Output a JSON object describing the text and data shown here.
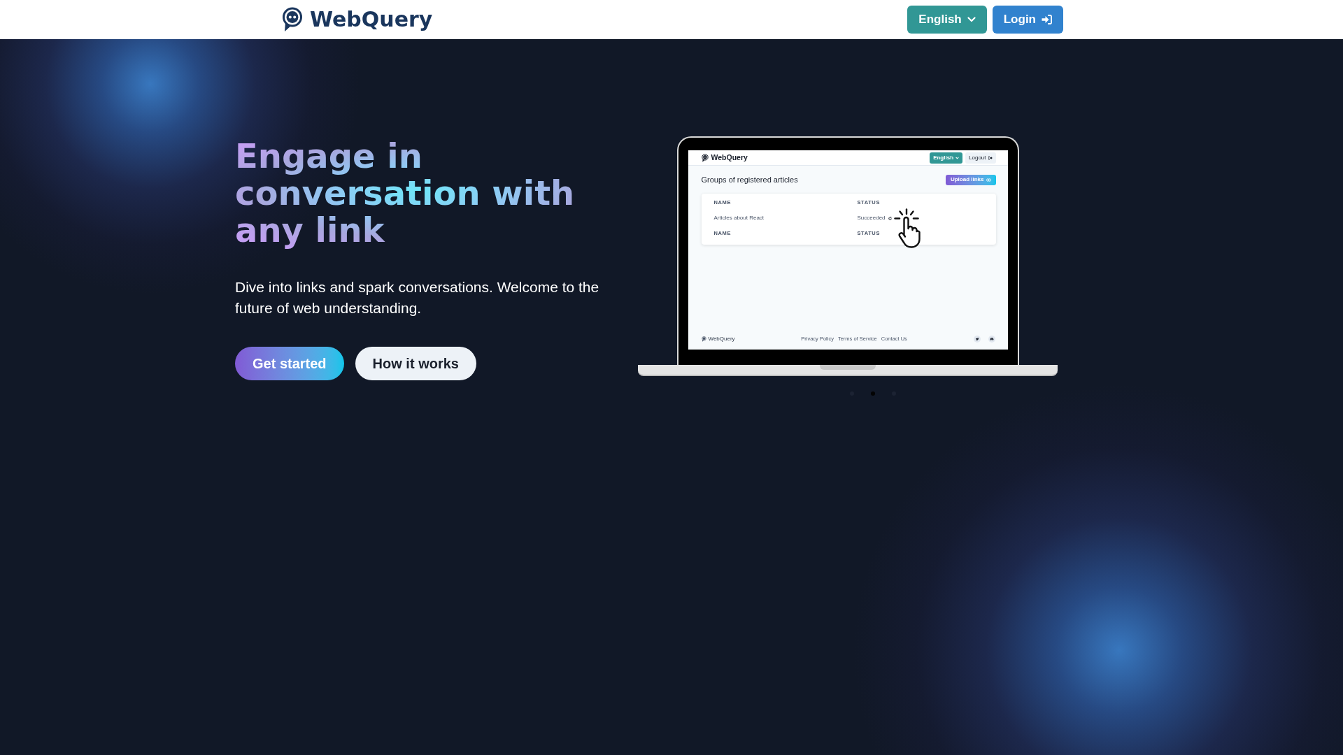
{
  "header": {
    "brand": "WebQuery",
    "language_button": "English",
    "login_button": "Login"
  },
  "hero": {
    "title": "Engage in conversation with any link",
    "subtitle": "Dive into links and spark conversations. Welcome to the future of web understanding.",
    "buttons": [
      {
        "label": "Get started",
        "kind": "primary"
      },
      {
        "label": "How it works",
        "kind": "secondary"
      }
    ]
  },
  "showcase": {
    "screen": {
      "header": {
        "brand": "WebQuery",
        "language_button": "English",
        "logout_button": "Logout"
      },
      "page_title": "Groups of registered articles",
      "upload_button": "Upload links",
      "table": {
        "columns": [
          "NAME",
          "STATUS"
        ],
        "rows": [
          {
            "name": "Articles about React",
            "status": "Succeeded"
          }
        ],
        "footer_columns": [
          "NAME",
          "STATUS"
        ]
      },
      "footer": {
        "brand": "WebQuery",
        "links": [
          "Privacy Policy",
          "Terms of Service",
          "Contact Us"
        ]
      }
    },
    "carousel_dots": [
      {
        "selected": false
      },
      {
        "selected": true
      },
      {
        "selected": false
      }
    ]
  }
}
